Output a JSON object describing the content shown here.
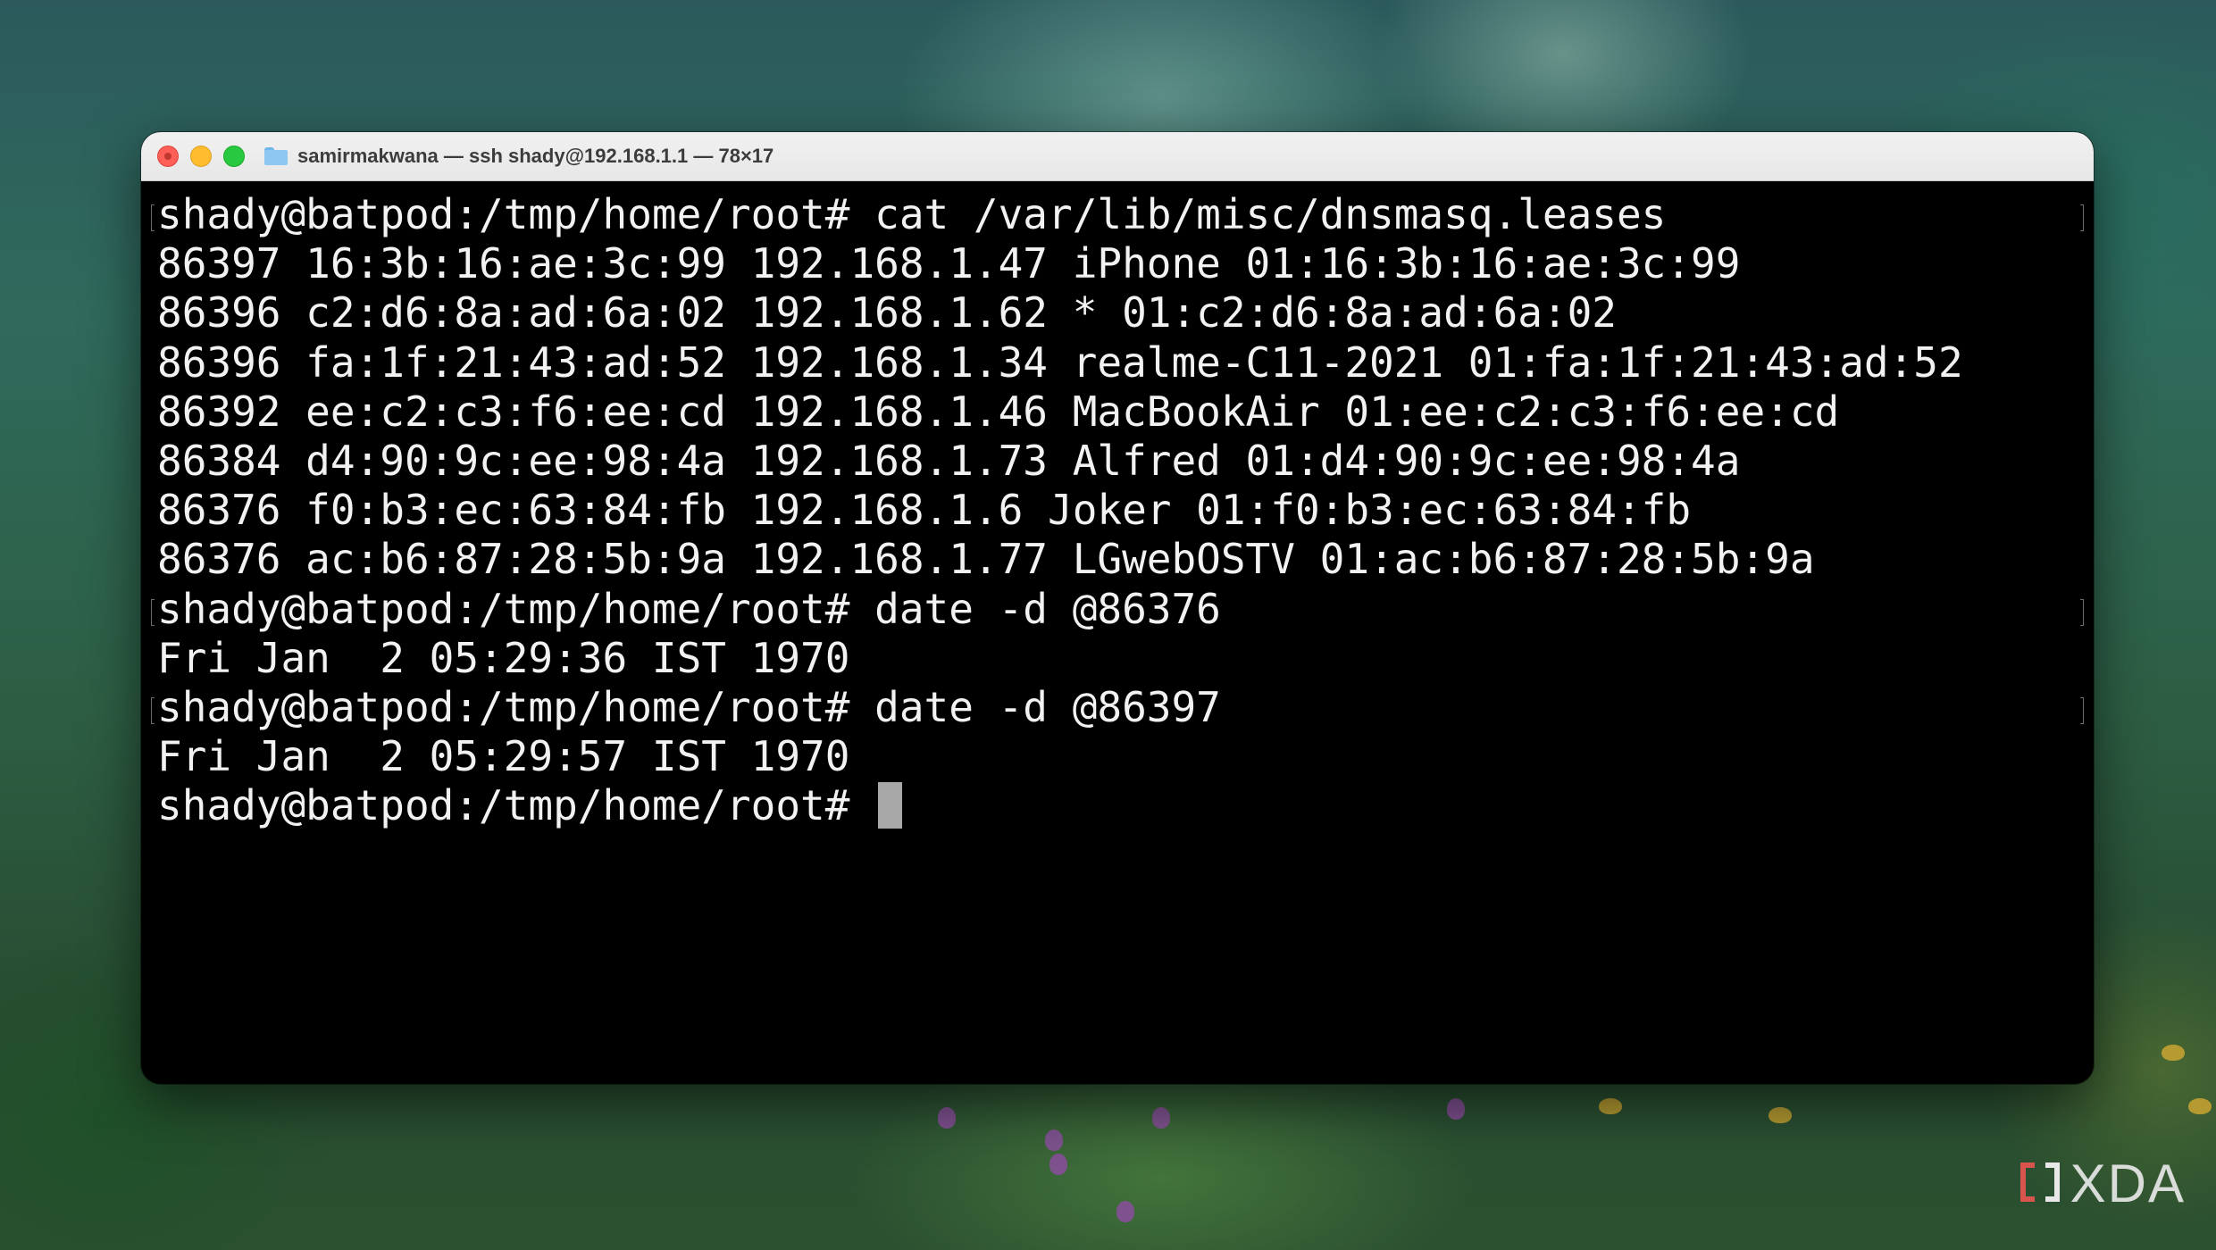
{
  "window": {
    "title": "samirmakwana — ssh shady@192.168.1.1 — 78×17"
  },
  "terminal": {
    "lines": [
      "shady@batpod:/tmp/home/root# cat /var/lib/misc/dnsmasq.leases",
      "86397 16:3b:16:ae:3c:99 192.168.1.47 iPhone 01:16:3b:16:ae:3c:99",
      "86396 c2:d6:8a:ad:6a:02 192.168.1.62 * 01:c2:d6:8a:ad:6a:02",
      "86396 fa:1f:21:43:ad:52 192.168.1.34 realme-C11-2021 01:fa:1f:21:43:ad:52",
      "86392 ee:c2:c3:f6:ee:cd 192.168.1.46 MacBookAir 01:ee:c2:c3:f6:ee:cd",
      "86384 d4:90:9c:ee:98:4a 192.168.1.73 Alfred 01:d4:90:9c:ee:98:4a",
      "86376 f0:b3:ec:63:84:fb 192.168.1.6 Joker 01:f0:b3:ec:63:84:fb",
      "86376 ac:b6:87:28:5b:9a 192.168.1.77 LGwebOSTV 01:ac:b6:87:28:5b:9a",
      "shady@batpod:/tmp/home/root# date -d @86376",
      "Fri Jan  2 05:29:36 IST 1970",
      "shady@batpod:/tmp/home/root# date -d @86397",
      "Fri Jan  2 05:29:57 IST 1970",
      "shady@batpod:/tmp/home/root# "
    ]
  },
  "watermark": {
    "brand": "XDA"
  },
  "colors": {
    "terminal_background": "#000000",
    "terminal_text": "#f2f2f2",
    "close": "#ff5f57",
    "minimize": "#febc2e",
    "zoom": "#28c840"
  }
}
